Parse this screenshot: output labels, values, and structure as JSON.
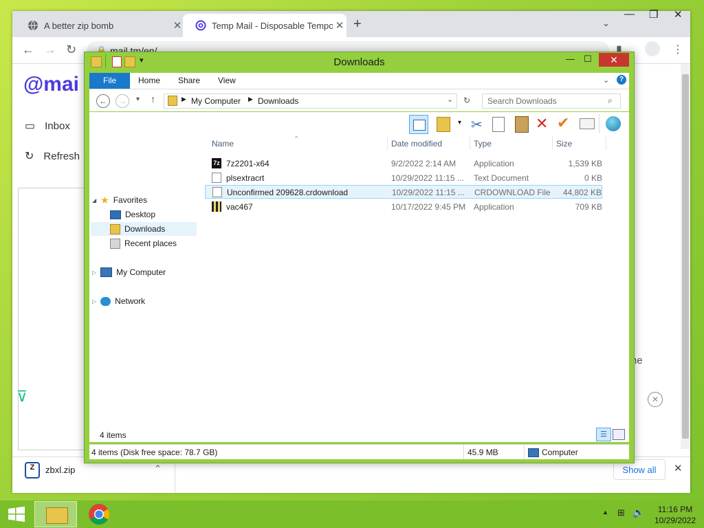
{
  "browser": {
    "tabs": [
      {
        "title": "A better zip bomb",
        "active": false
      },
      {
        "title": "Temp Mail - Disposable Tempora",
        "active": true
      }
    ],
    "new_tab_glyph": "+",
    "url": "mail.tm/en/",
    "page": {
      "logo": "mai",
      "sidebar": [
        {
          "label": "Inbox",
          "icon": "inbox-icon"
        },
        {
          "label": "Refresh",
          "icon": "refresh-icon"
        }
      ],
      "partial_text": "ne"
    },
    "download": {
      "filename": "zbxl.zip",
      "show_all": "Show all"
    }
  },
  "explorer": {
    "title": "Downloads",
    "ribbon_tabs": [
      "File",
      "Home",
      "Share",
      "View"
    ],
    "breadcrumb": [
      "My Computer",
      "Downloads"
    ],
    "search_placeholder": "Search Downloads",
    "nav": {
      "favorites": "Favorites",
      "favorite_items": [
        "Desktop",
        "Downloads",
        "Recent places"
      ],
      "computer": "My Computer",
      "network": "Network"
    },
    "columns": {
      "name": "Name",
      "date": "Date modified",
      "type": "Type",
      "size": "Size"
    },
    "files": [
      {
        "name": "7z2201-x64",
        "date": "9/2/2022 2:14 AM",
        "type": "Application",
        "size": "1,539 KB"
      },
      {
        "name": "plsextracrt",
        "date": "10/29/2022 11:15 ...",
        "type": "Text Document",
        "size": "0 KB"
      },
      {
        "name": "Unconfirmed 209628.crdownload",
        "date": "10/29/2022 11:15 ...",
        "type": "CRDOWNLOAD File",
        "size": "44,802 KB"
      },
      {
        "name": "vac467",
        "date": "10/17/2022 9:45 PM",
        "type": "Application",
        "size": "709 KB"
      }
    ],
    "item_count": "4 items",
    "status": {
      "left": "4 items (Disk free space: 78.7 GB)",
      "size": "45.9 MB",
      "location": "Computer"
    }
  },
  "taskbar": {
    "time": "11:16 PM",
    "date": "10/29/2022"
  },
  "colors": {
    "accent_green": "#94cf3f",
    "ribbon_file": "#1979ca",
    "close_red": "#c7372f",
    "mail_brand": "#4b3be0"
  }
}
